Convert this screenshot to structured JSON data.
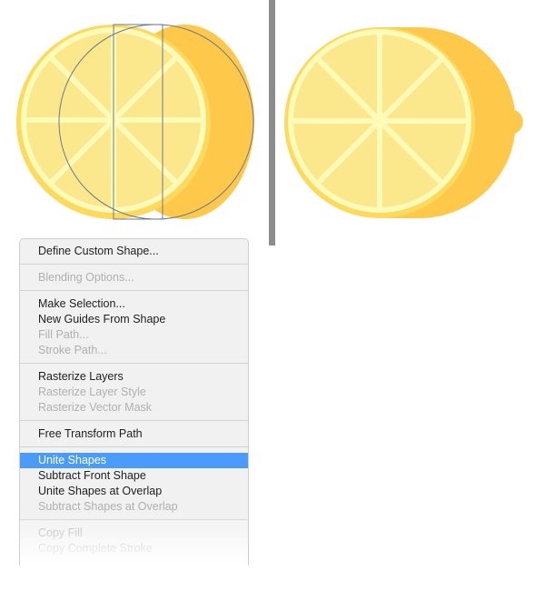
{
  "colors": {
    "peel": "#fec94b",
    "rind": "#fdd95e",
    "flesh": "#fbe88c",
    "segment_line": "#fefab8",
    "outline": "#6b7a8f",
    "divider": "#8c8c8c",
    "menu_background": "#f1f1f1",
    "menu_highlight": "#4b9cfa"
  },
  "illustration": {
    "left_panel": "lemon-slice-with-path-overlays",
    "right_panel": "lemon-slice-united"
  },
  "context_menu": {
    "groups": [
      [
        {
          "label": "Define Custom Shape...",
          "enabled": true
        }
      ],
      [
        {
          "label": "Blending Options...",
          "enabled": false
        }
      ],
      [
        {
          "label": "Make Selection...",
          "enabled": true
        },
        {
          "label": "New Guides From Shape",
          "enabled": true
        },
        {
          "label": "Fill Path...",
          "enabled": false
        },
        {
          "label": "Stroke Path...",
          "enabled": false
        }
      ],
      [
        {
          "label": "Rasterize Layers",
          "enabled": true
        },
        {
          "label": "Rasterize Layer Style",
          "enabled": false
        },
        {
          "label": "Rasterize Vector Mask",
          "enabled": false
        }
      ],
      [
        {
          "label": "Free Transform Path",
          "enabled": true
        }
      ],
      [
        {
          "label": "Unite Shapes",
          "enabled": true,
          "selected": true
        },
        {
          "label": "Subtract Front Shape",
          "enabled": true
        },
        {
          "label": "Unite Shapes at Overlap",
          "enabled": true
        },
        {
          "label": "Subtract Shapes at Overlap",
          "enabled": false
        }
      ],
      [
        {
          "label": "Copy Fill",
          "enabled": false
        },
        {
          "label": "Copy Complete Stroke",
          "enabled": false
        }
      ]
    ]
  }
}
